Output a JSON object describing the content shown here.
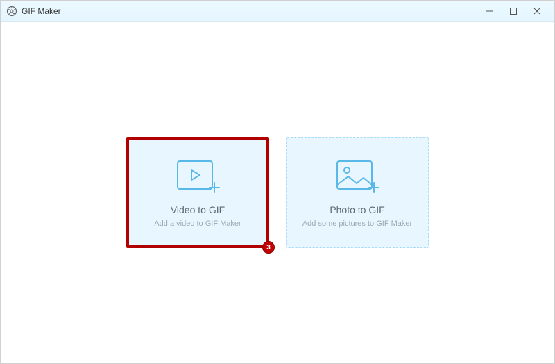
{
  "window": {
    "title": "GIF Maker"
  },
  "cards": {
    "video": {
      "title": "Video to GIF",
      "subtitle": "Add a video to GIF Maker"
    },
    "photo": {
      "title": "Photo to GIF",
      "subtitle": "Add some pictures to GIF Maker"
    }
  },
  "annotation": {
    "badge": "3"
  }
}
